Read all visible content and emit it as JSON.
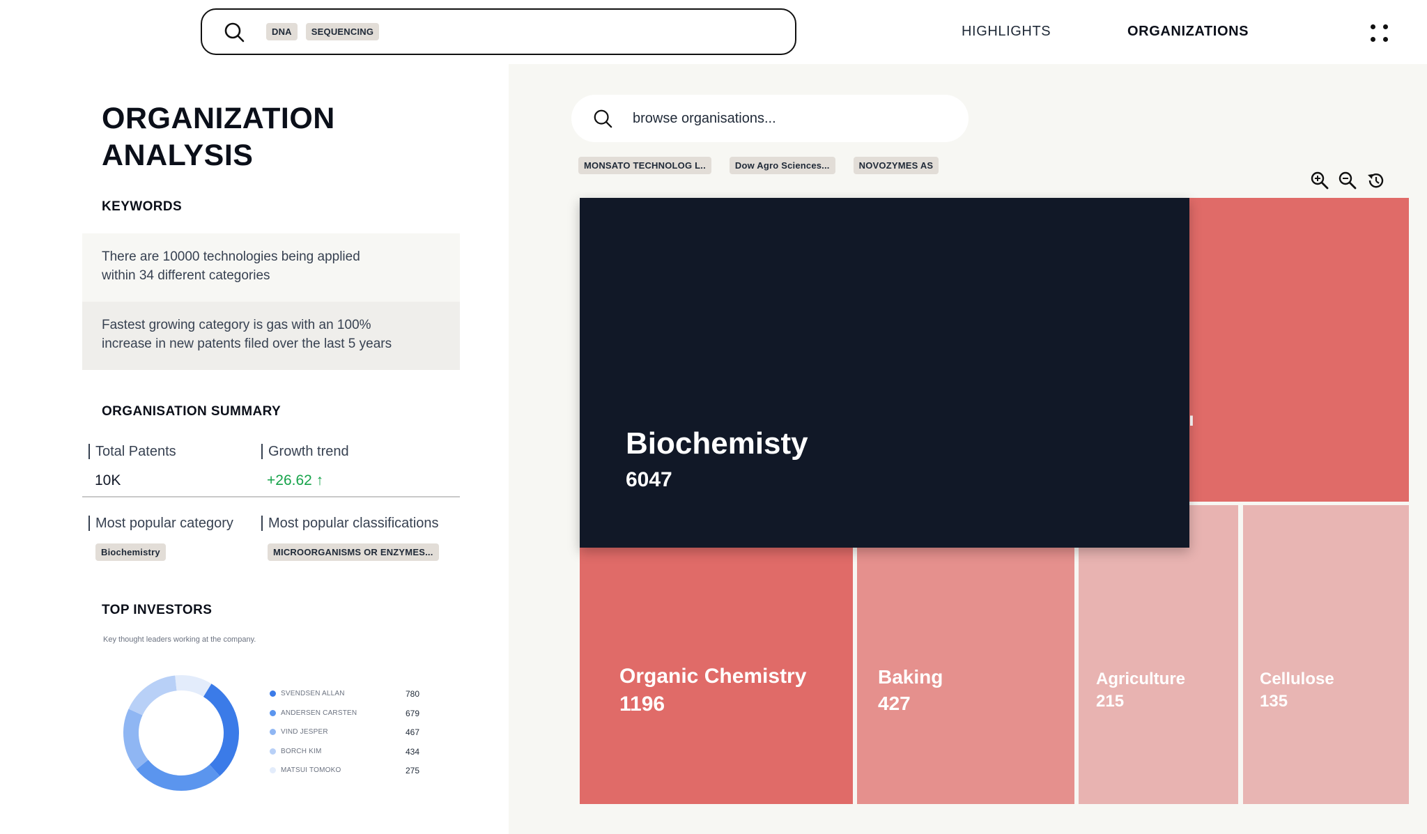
{
  "topbar": {
    "search_chips": [
      "DNA",
      "SEQUENCING"
    ],
    "nav": {
      "highlights": "HIGHLIGHTS",
      "organizations": "ORGANIZATIONS"
    },
    "icons": {
      "search": "search-icon",
      "menu": "grid-dots-icon"
    }
  },
  "page": {
    "title_line1": "ORGANIZATION",
    "title_line2": "ANALYSIS"
  },
  "keywords": {
    "heading": "KEYWORDS",
    "insight1_line1": "There are 10000 technologies being applied",
    "insight1_line2": "within 34 different categories",
    "insight2_line1": "Fastest growing category is gas with an 100%",
    "insight2_line2": "increase in new patents filed over the last 5 years"
  },
  "summary": {
    "heading": "ORGANISATION SUMMARY",
    "total_patents_label": "Total Patents",
    "total_patents_value": "10K",
    "growth_label": "Growth trend",
    "growth_value": "+26.62 ↑",
    "growth_color": "#16a34a",
    "popular_category_label": "Most popular category",
    "popular_category_value": "Biochemistry",
    "popular_class_label": "Most popular classifications",
    "popular_class_value": "MICROORGANISMS OR ENZYMES..."
  },
  "investors": {
    "heading": "TOP INVESTORS",
    "subtext": "Key thought leaders working at the company.",
    "items": [
      {
        "name": "SVENDSEN ALLAN",
        "value": "780",
        "color": "#3b7be8"
      },
      {
        "name": "ANDERSEN CARSTEN",
        "value": "679",
        "color": "#5b95ee"
      },
      {
        "name": "VIND JESPER",
        "value": "467",
        "color": "#8fb6f3"
      },
      {
        "name": "BORCH KIM",
        "value": "434",
        "color": "#b8d0f7"
      },
      {
        "name": "MATSUI TOMOKO",
        "value": "275",
        "color": "#e3ecfb"
      }
    ]
  },
  "organisations": {
    "search_placeholder": "browse organisations...",
    "chips": [
      "MONSATO TECHNOLOG L..",
      "Dow Agro Sciences...",
      "NOVOZYMES AS"
    ],
    "tools": [
      "zoom-in-icon",
      "zoom-out-icon",
      "history-reset-icon"
    ]
  },
  "treemap": {
    "hovered": {
      "name": "Biochemisty",
      "value": "6047",
      "color": "#111827"
    },
    "cells": [
      {
        "name": "Organic Chemistry",
        "value": "1196",
        "color": "#e06b68"
      },
      {
        "name": "Baking",
        "value": "427",
        "color": "#e5908d"
      },
      {
        "name": "Agriculture",
        "value": "215",
        "color": "#e8b3b1"
      },
      {
        "name": "Cellulose",
        "value": "135",
        "color": "#e8b5b3"
      }
    ],
    "top_right_color": "#e06b68"
  }
}
